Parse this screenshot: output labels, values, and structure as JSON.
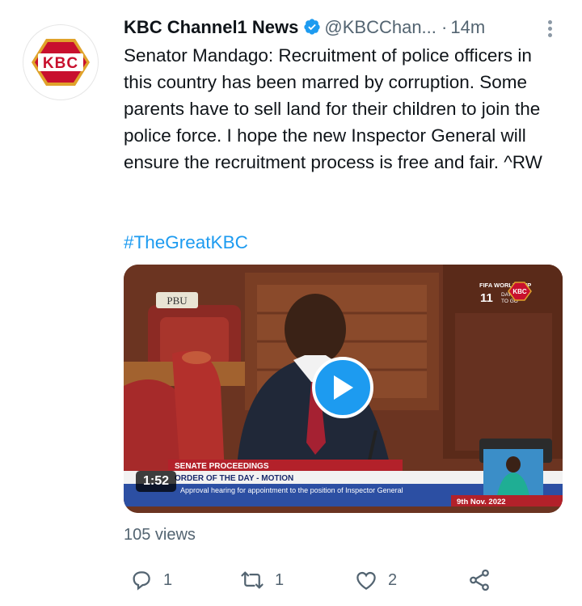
{
  "tweet": {
    "author_name": "KBC Channel1 News",
    "handle": "@KBCChan...",
    "separator": "·",
    "time": "14m",
    "avatar_text": "KBC",
    "text": "Senator Mandago: Recruitment of police officers in this country has been marred by corruption. Some parents have to sell land for their children to join the police force. I hope the new Inspector General will ensure the recruitment process is free and fair. ^RW",
    "hashtag": "#TheGreatKBC",
    "views": "105 views"
  },
  "video": {
    "duration": "1:52",
    "channel_badge": "PBU",
    "countdown_title": "FIFA WORLD CUP",
    "countdown_number": "11",
    "countdown_unit": "DAYS",
    "countdown_suffix": "TO GO",
    "corner_logo": "KBC",
    "ticker_label": "SENATE PROCEEDINGS",
    "ticker_headline": "ORDER OF THE DAY - MOTION",
    "ticker_subline": "Approval hearing for appointment to the position of Inspector General",
    "ticker_date": "9th Nov. 2022"
  },
  "actions": {
    "reply_count": "1",
    "retweet_count": "1",
    "like_count": "2"
  },
  "colors": {
    "accent": "#1d9bf0",
    "muted": "#536471",
    "kbc_red": "#c8102e",
    "kbc_gold": "#e0a32b"
  },
  "icons": [
    "kbc-logo-icon",
    "verified-badge-icon",
    "more-options-icon",
    "play-icon",
    "reply-icon",
    "retweet-icon",
    "like-icon",
    "share-icon"
  ]
}
